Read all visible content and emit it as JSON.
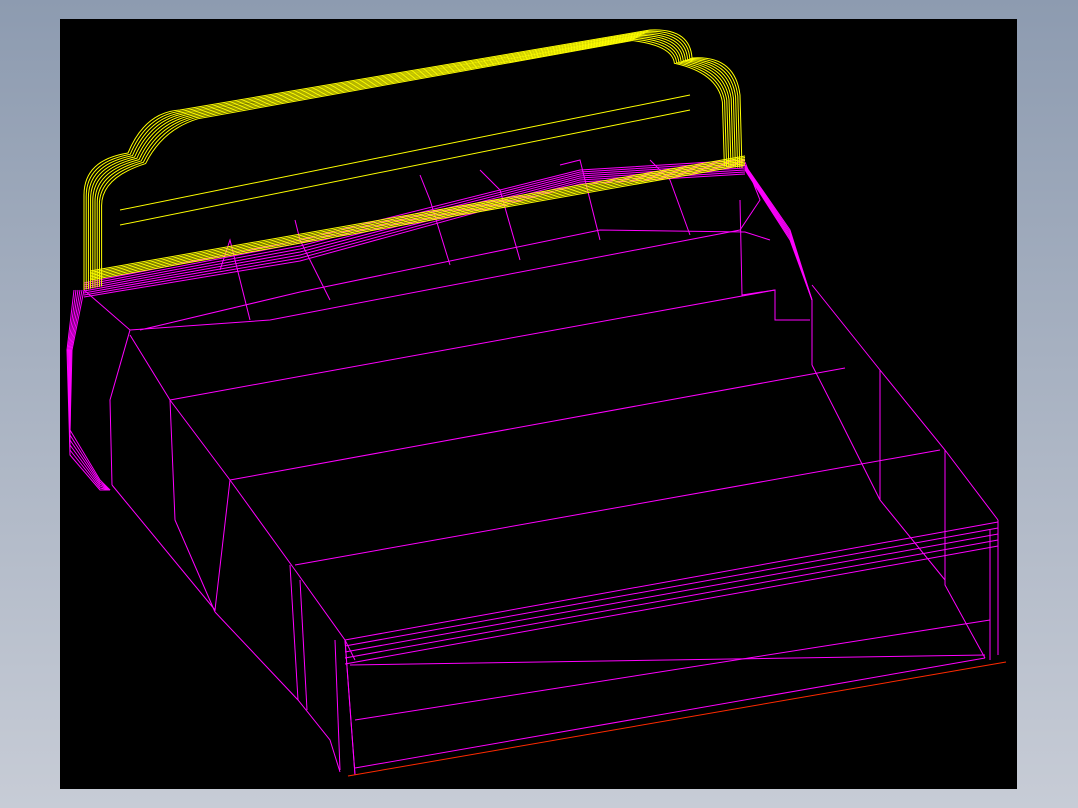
{
  "window": {
    "background_top": "#8d9bb0",
    "background_bottom": "#c7ccd6"
  },
  "viewport": {
    "background": "#000000",
    "model": "bed-wireframe",
    "colors": {
      "headboard": "#ffff00",
      "body": "#ff00ff",
      "axis": "#ff2a00"
    }
  }
}
